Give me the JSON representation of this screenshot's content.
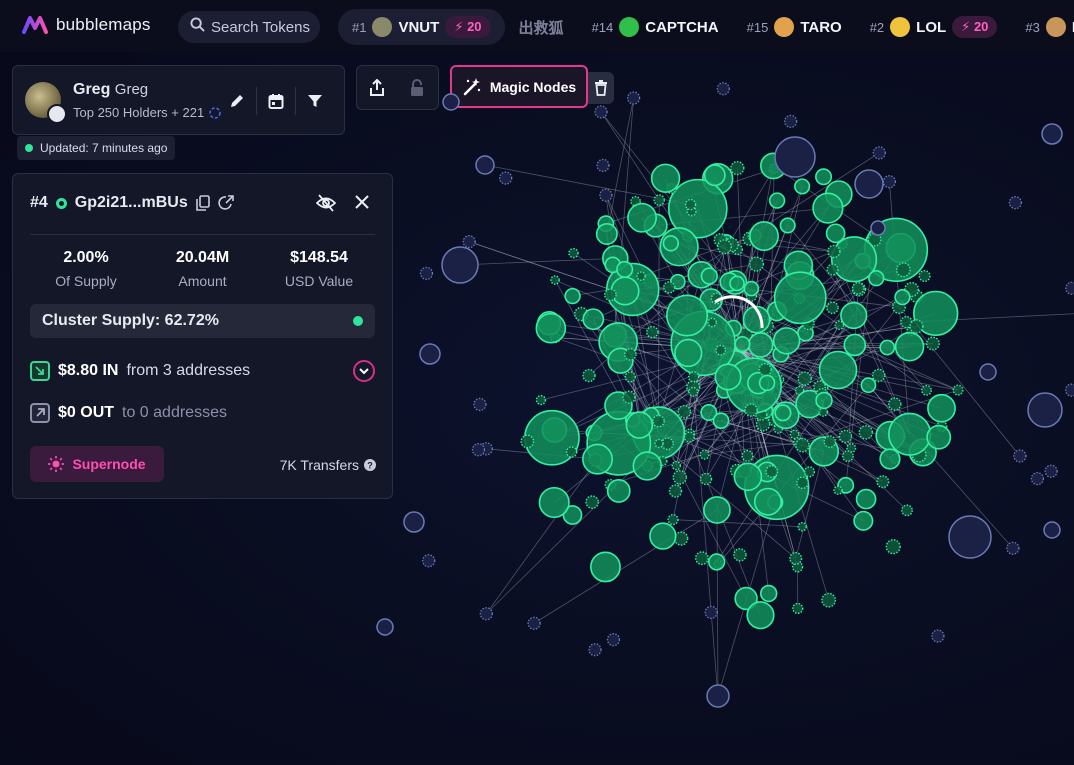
{
  "brand": {
    "name": "bubblemaps"
  },
  "search": {
    "placeholder": "Search Tokens"
  },
  "ticker": [
    {
      "rank": "#1",
      "symbol": "VNUT",
      "boost": "20",
      "active": true,
      "avatar_color": "#8a8a6a"
    },
    {
      "rank": "",
      "symbol": "出救狐",
      "boost": "",
      "faded": true,
      "avatar_color": ""
    },
    {
      "rank": "#14",
      "symbol": "CAPTCHA",
      "boost": "",
      "avatar_color": "#2fbf4a"
    },
    {
      "rank": "#15",
      "symbol": "TARO",
      "boost": "",
      "avatar_color": "#e2a24b"
    },
    {
      "rank": "#2",
      "symbol": "LOL",
      "boost": "20",
      "avatar_color": "#f0c33c"
    },
    {
      "rank": "#3",
      "symbol": "PUNCH",
      "boost": "",
      "avatar_color": "#c9955a"
    }
  ],
  "wallet": {
    "name": "Greg",
    "alias": "Greg",
    "subtitle": "Top 250 Holders + 221"
  },
  "updated": "Updated: 7 minutes ago",
  "magic_nodes": "Magic Nodes",
  "detail": {
    "rank": "#4",
    "address": "Gp2i21...mBUs",
    "stats": [
      {
        "value": "2.00%",
        "label": "Of Supply"
      },
      {
        "value": "20.04M",
        "label": "Amount"
      },
      {
        "value": "$148.54",
        "label": "USD Value"
      }
    ],
    "cluster_supply": "Cluster Supply: 62.72%",
    "inflow": {
      "amount": "$8.80 IN",
      "desc": "from 3 addresses"
    },
    "outflow": {
      "amount": "$0 OUT",
      "desc": "to 0 addresses"
    },
    "supernode": "Supernode",
    "transfers": "7K Transfers"
  },
  "colors": {
    "accent_green": "#2ee59a",
    "accent_pink": "#e0398d",
    "node_green": "#1fa66c",
    "node_blue": "#1c2447"
  }
}
